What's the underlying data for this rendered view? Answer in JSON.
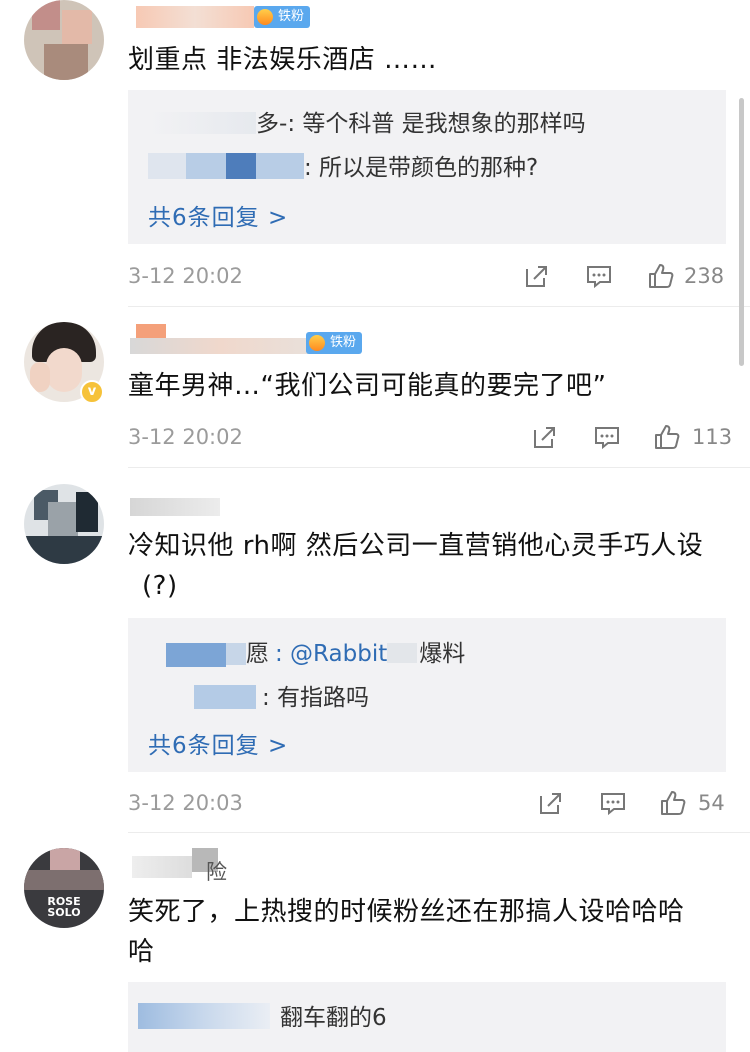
{
  "comments": [
    {
      "text": "划重点 非法娱乐酒店 ……",
      "badge": "铁粉",
      "replies": [
        {
          "author_tail": "多-",
          "text": ": 等个科普 是我想象的那样吗"
        },
        {
          "author_tail": "",
          "text": ": 所以是带颜色的那种?"
        }
      ],
      "more_replies": "共6条回复 >",
      "time": "3-12 20:02",
      "likes": "238"
    },
    {
      "text": "童年男神…“我们公司可能真的要完了吧”",
      "badge": "铁粉",
      "time": "3-12 20:02",
      "likes": "113"
    },
    {
      "text_line1": "冷知识他 rh啊 然后公司一直营销他心灵手巧人设",
      "text_line2": "(?)",
      "replies": [
        {
          "author_tail": "愿",
          "text": ": @Rabbit",
          "tail_text": "爆料"
        },
        {
          "author_tail": "",
          "text": ": 有指路吗"
        }
      ],
      "more_replies": "共6条回复 >",
      "time": "3-12 20:03",
      "likes": "54"
    },
    {
      "author_tail": "险",
      "avatar_text_1": "ROSE",
      "avatar_text_2": "SOLO",
      "text_line1": "笑死了，上热搜的时候粉丝还在那搞人设哈哈哈",
      "text_line2": "哈",
      "replies": [
        {
          "text": "翻车翻的6"
        }
      ]
    }
  ],
  "icons": {
    "share": "share-icon",
    "comment": "comment-icon",
    "like": "like-icon"
  },
  "colors": {
    "link": "#2f6cb4",
    "badge": "#5aa8ee",
    "reply_bg": "#f2f2f4",
    "meta": "#9b9b9b"
  }
}
